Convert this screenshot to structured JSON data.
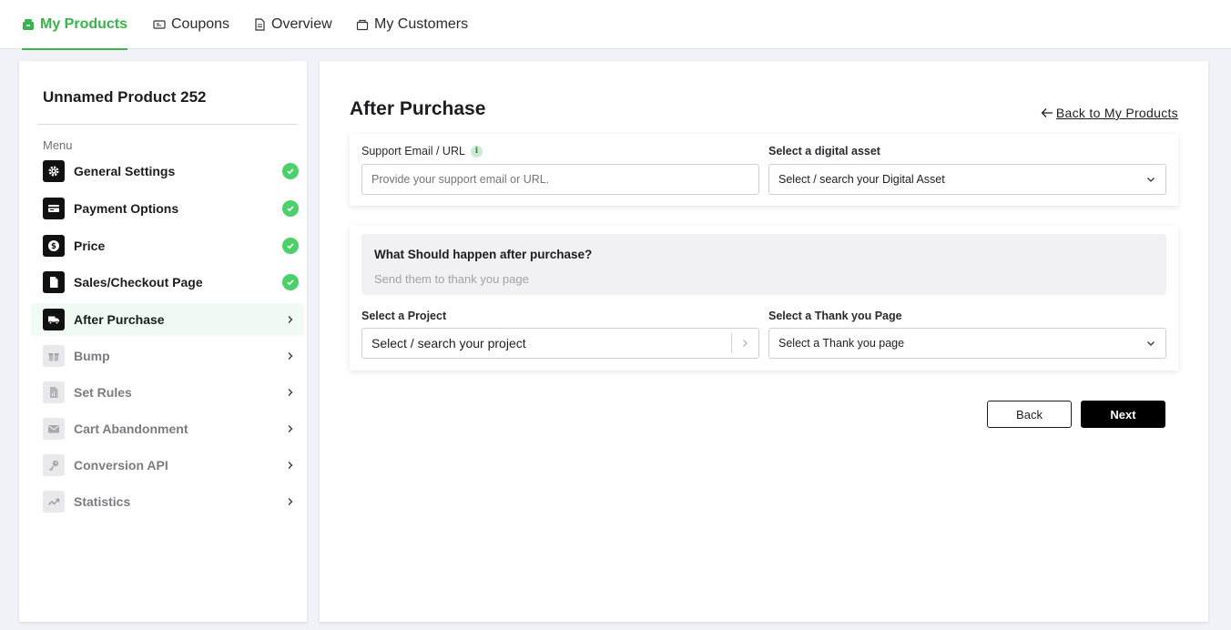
{
  "nav": {
    "tabs": [
      {
        "label": "My Products",
        "icon": "store-icon",
        "active": true
      },
      {
        "label": "Coupons",
        "icon": "ticket-icon",
        "active": false
      },
      {
        "label": "Overview",
        "icon": "document-icon",
        "active": false
      },
      {
        "label": "My Customers",
        "icon": "customers-icon",
        "active": false
      }
    ],
    "accent_color": "#35b54a"
  },
  "sidebar": {
    "product_title": "Unnamed Product 252",
    "menu_label": "Menu",
    "items": [
      {
        "label": "General Settings",
        "icon": "gear-icon",
        "status": "complete"
      },
      {
        "label": "Payment Options",
        "icon": "card-icon",
        "status": "complete"
      },
      {
        "label": "Price",
        "icon": "dollar-icon",
        "status": "complete"
      },
      {
        "label": "Sales/Checkout Page",
        "icon": "page-icon",
        "status": "complete"
      },
      {
        "label": "After Purchase",
        "icon": "truck-icon",
        "status": "current"
      },
      {
        "label": "Bump",
        "icon": "gift-icon",
        "status": "pending"
      },
      {
        "label": "Set Rules",
        "icon": "rules-icon",
        "status": "pending"
      },
      {
        "label": "Cart Abandonment",
        "icon": "mail-icon",
        "status": "pending"
      },
      {
        "label": "Conversion API",
        "icon": "key-icon",
        "status": "pending"
      },
      {
        "label": "Statistics",
        "icon": "trend-icon",
        "status": "pending"
      }
    ]
  },
  "main": {
    "title": "After Purchase",
    "back_link": "Back to My Products",
    "support": {
      "label": "Support Email / URL",
      "placeholder": "Provide your support email or URL.",
      "value": ""
    },
    "digital_asset": {
      "label": "Select a digital asset",
      "selected": "Select / search your Digital Asset"
    },
    "after_purchase": {
      "question": "What Should happen after purchase?",
      "answer": "Send them to thank you page"
    },
    "project": {
      "label": "Select a Project",
      "selected": "Select / search your project"
    },
    "thank_you_page": {
      "label": "Select a Thank you Page",
      "selected": "Select a Thank you page"
    },
    "buttons": {
      "back": "Back",
      "next": "Next"
    }
  }
}
